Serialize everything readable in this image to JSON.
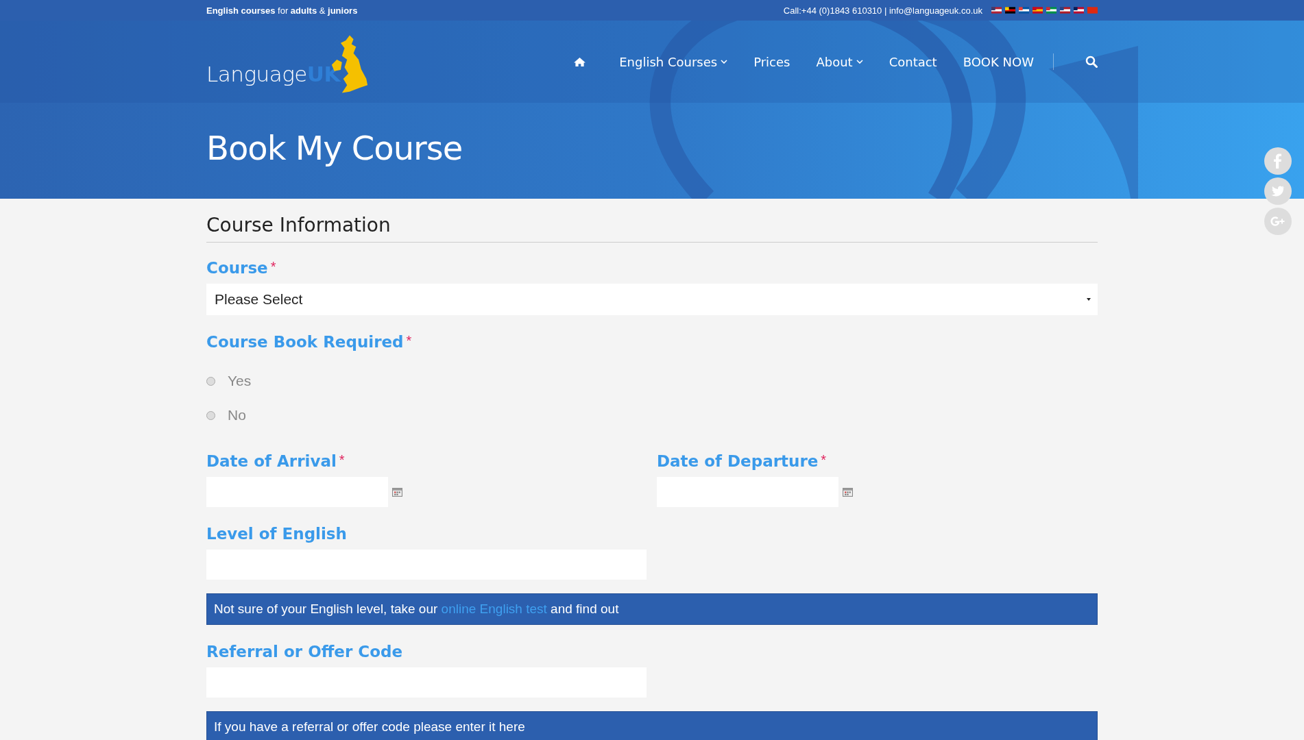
{
  "top_bar": {
    "tagline": "**English courses** for **adults** & **juniors**",
    "contact": "Call:+44 (0)1843 610310 | info@languageuk.co.uk"
  },
  "logo": {
    "text": "Language",
    "accent": "UK"
  },
  "nav": [
    {
      "kind": "home"
    },
    {
      "kind": "link",
      "label": "English Courses",
      "dropdown": true
    },
    {
      "kind": "link",
      "label": "Prices",
      "dropdown": false
    },
    {
      "kind": "link",
      "label": "About",
      "dropdown": true
    },
    {
      "kind": "link",
      "label": "Contact",
      "dropdown": false
    },
    {
      "kind": "link",
      "label": "BOOK NOW",
      "dropdown": false
    },
    {
      "kind": "search"
    }
  ],
  "hero": {
    "title": "Book My Course"
  },
  "form": {
    "section_title": "Course Information",
    "fields": [
      {
        "kind": "select",
        "label": "Course",
        "required_mark": "*",
        "value": "Please Select"
      },
      {
        "kind": "radio",
        "label": "Course Book Required",
        "required_mark": "*",
        "options": [
          {
            "label": "Yes",
            "selected": false
          },
          {
            "label": "No",
            "selected": false
          }
        ]
      },
      {
        "kind": "date_pair",
        "items": [
          {
            "label": "Date of Arrival",
            "required_mark": "*"
          },
          {
            "label": "Date of Departure",
            "required_mark": "*"
          }
        ]
      },
      {
        "kind": "text",
        "label": "Level of English"
      },
      {
        "kind": "note",
        "before": "Not sure of your English level, take our ",
        "link": "online English test",
        "after": " and find out"
      },
      {
        "kind": "text",
        "label": "Referral or Offer Code"
      },
      {
        "kind": "note",
        "before": "If you have a referral or offer code please enter it here"
      }
    ]
  }
}
